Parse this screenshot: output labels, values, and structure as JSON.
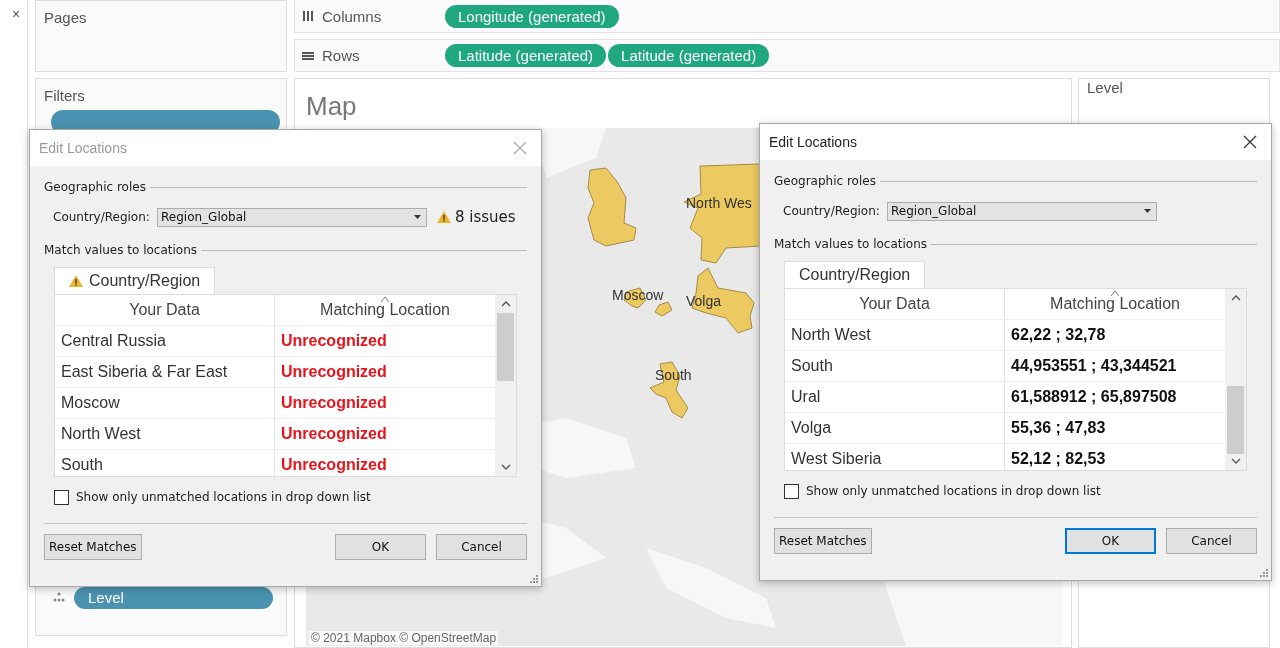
{
  "sidebar": {
    "close": "×",
    "pages": {
      "title": "Pages"
    },
    "filters": {
      "title": "Filters"
    },
    "marks": {
      "pill": "Level"
    }
  },
  "shelves": [
    {
      "kind": "columns",
      "label": "Columns",
      "pills": [
        "Longitude (generated)"
      ]
    },
    {
      "kind": "rows",
      "label": "Rows",
      "pills": [
        "Latitude (generated)",
        "Latitude (generated)"
      ]
    }
  ],
  "map": {
    "title": "Map",
    "labels": [
      "North Wes",
      "Moscow",
      "Volga",
      "South"
    ],
    "attribution": "© 2021 Mapbox © OpenStreetMap"
  },
  "legend": {
    "title": "Level"
  },
  "dialogs": [
    {
      "title": "Edit Locations",
      "active": false,
      "section_roles": "Geographic roles",
      "role_label": "Country/Region:",
      "role_value": "Region_Global",
      "issues": "8 issues",
      "section_match": "Match values to locations",
      "tab": {
        "label": "Country/Region",
        "warning": true
      },
      "columns": [
        "Your Data",
        "Matching Location"
      ],
      "rows": [
        {
          "data": "Central Russia",
          "location": "Unrecognized",
          "matched": false
        },
        {
          "data": "East Siberia & Far East",
          "location": "Unrecognized",
          "matched": false
        },
        {
          "data": "Moscow",
          "location": "Unrecognized",
          "matched": false
        },
        {
          "data": "North West",
          "location": "Unrecognized",
          "matched": false
        },
        {
          "data": "South",
          "location": "Unrecognized",
          "matched": false
        }
      ],
      "checkbox": {
        "label": "Show only unmatched locations in drop down list",
        "checked": false
      },
      "buttons": {
        "reset": "Reset Matches",
        "ok": "OK",
        "cancel": "Cancel",
        "ok_default": false
      }
    },
    {
      "title": "Edit Locations",
      "active": true,
      "section_roles": "Geographic roles",
      "role_label": "Country/Region:",
      "role_value": "Region_Global",
      "section_match": "Match values to locations",
      "tab": {
        "label": "Country/Region",
        "warning": false
      },
      "columns": [
        "Your Data",
        "Matching Location"
      ],
      "rows": [
        {
          "data": "North West",
          "location": "62,22 ; 32,78",
          "matched": true
        },
        {
          "data": "South",
          "location": "44,953551 ; 43,344521",
          "matched": true
        },
        {
          "data": "Ural",
          "location": "61,588912 ; 65,897508",
          "matched": true
        },
        {
          "data": "Volga",
          "location": "55,36 ; 47,83",
          "matched": true
        },
        {
          "data": "West Siberia",
          "location": "52,12 ; 82,53",
          "matched": true
        }
      ],
      "checkbox": {
        "label": "Show only unmatched locations in drop down list",
        "checked": false
      },
      "buttons": {
        "reset": "Reset Matches",
        "ok": "OK",
        "cancel": "Cancel",
        "ok_default": true
      }
    }
  ]
}
